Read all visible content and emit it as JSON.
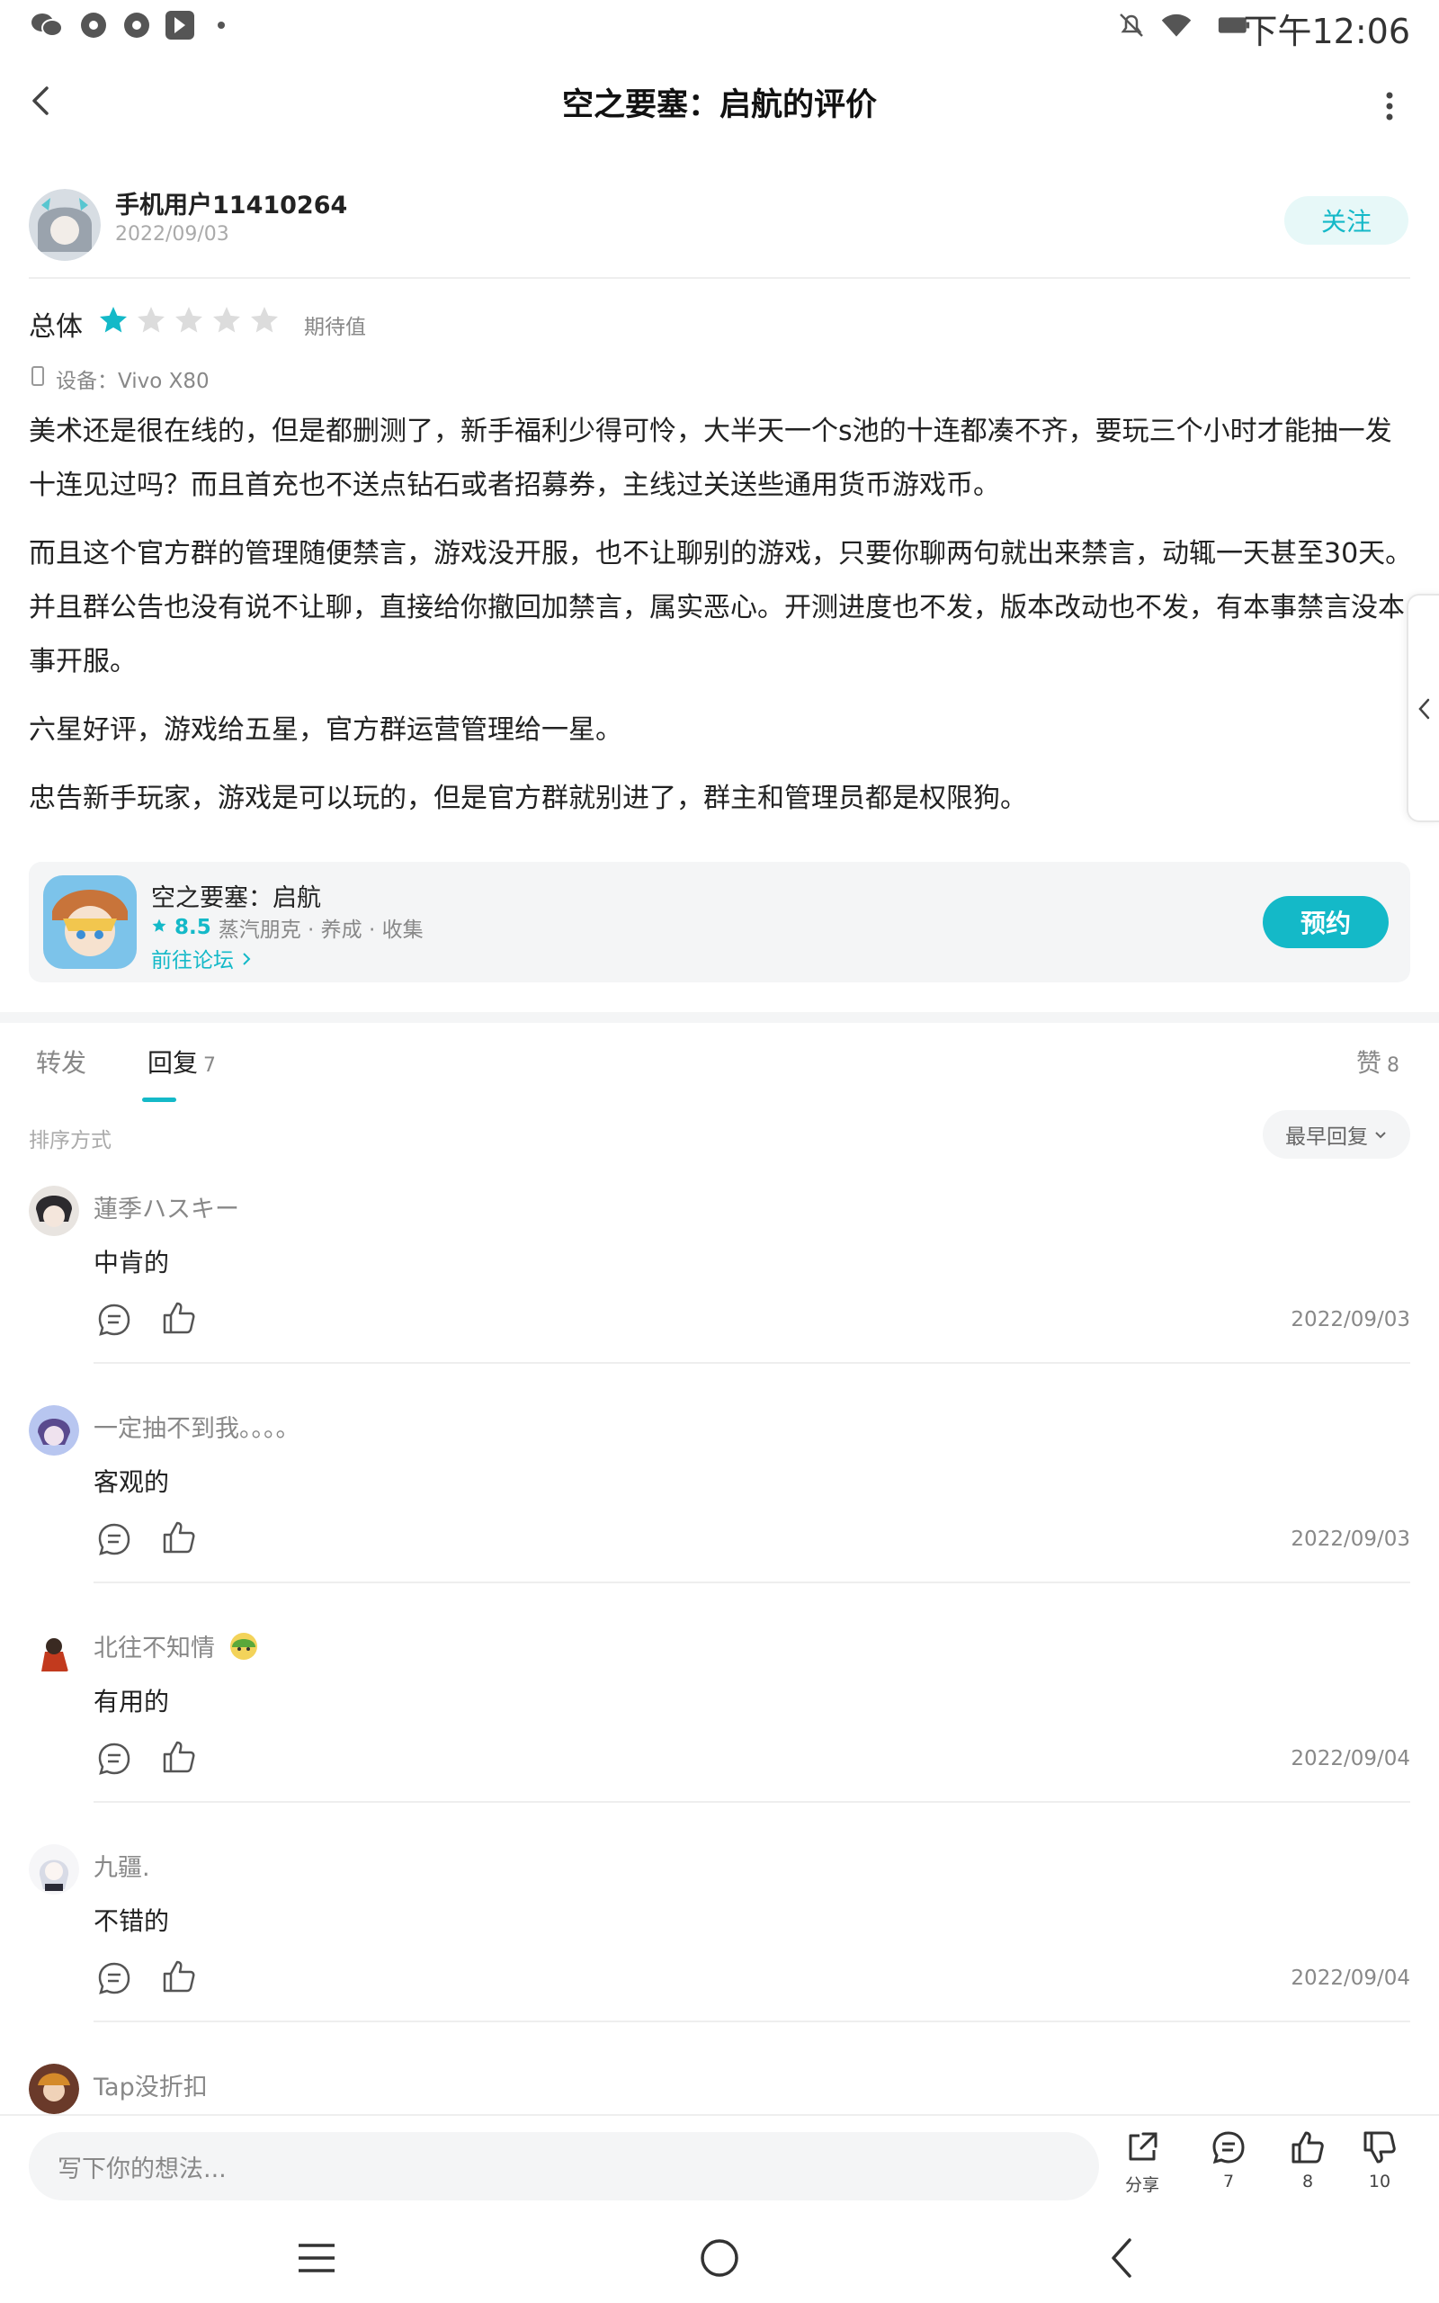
{
  "status_bar": {
    "time": "下午12:06",
    "left_icons": [
      "wechat-icon",
      "aperture-icon",
      "aperture-icon",
      "tap-app-icon",
      "dot-icon"
    ],
    "right_icons": [
      "bell-off-icon",
      "wifi-icon",
      "battery-icon"
    ]
  },
  "header": {
    "title": "空之要塞：启航的评价"
  },
  "review": {
    "author_name": "手机用户11410264",
    "date": "2022/09/03",
    "follow_label": "关注",
    "rating_label": "总体",
    "rating_stars": 1,
    "rating_max": 5,
    "rating_sub": "期待值",
    "device": "设备：Vivo X80",
    "paragraphs": [
      "美术还是很在线的，但是都删测了，新手福利少得可怜，大半天一个s池的十连都凑不齐，要玩三个小时才能抽一发十连见过吗？而且首充也不送点钻石或者招募券，主线过关送些通用货币游戏币。",
      "而且这个官方群的管理随便禁言，游戏没开服，也不让聊别的游戏，只要你聊两句就出来禁言，动辄一天甚至30天。并且群公告也没有说不让聊，直接给你撤回加禁言，属实恶心。开测进度也不发，版本改动也不发，有本事禁言没本事开服。",
      "六星好评，游戏给五星，官方群运营管理给一星。",
      "忠告新手玩家，游戏是可以玩的，但是官方群就别进了，群主和管理员都是权限狗。"
    ]
  },
  "game_card": {
    "title": "空之要塞：启航",
    "score": "8.5",
    "tags": "蒸汽朋克 · 养成 · 收集",
    "forum_link": "前往论坛",
    "reserve_label": "预约"
  },
  "tabs": {
    "repost": "转发",
    "reply": "回复",
    "reply_count": "7",
    "like": "赞",
    "like_count": "8"
  },
  "sort": {
    "label": "排序方式",
    "value": "最早回复"
  },
  "comments": [
    {
      "name": "蓮季ハスキー",
      "text": "中肯的",
      "date": "2022/09/03"
    },
    {
      "name": "一定抽不到我。。。。",
      "text": "客观的",
      "date": "2022/09/03"
    },
    {
      "name": "北往不知情",
      "text": "有用的",
      "date": "2022/09/04"
    },
    {
      "name": "九疆.",
      "text": "不错的",
      "date": "2022/09/04"
    },
    {
      "name": "Tap没折扣",
      "text": "",
      "date": ""
    }
  ],
  "bottom_bar": {
    "placeholder": "写下你的想法...",
    "share_label": "分享",
    "comment_count": "7",
    "like_count": "8",
    "dislike_count": "10"
  },
  "colors": {
    "accent": "#14b9c8",
    "follow_bg": "#e7f8f8",
    "card_bg": "#f4f5f6"
  }
}
